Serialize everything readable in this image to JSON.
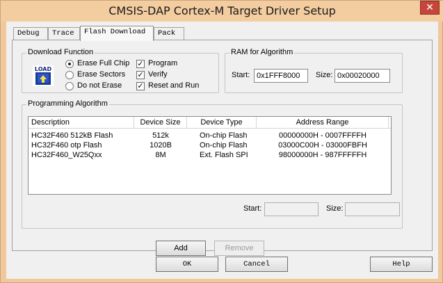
{
  "window": {
    "title": "CMSIS-DAP Cortex-M Target Driver Setup",
    "close_glyph": "✕"
  },
  "tabs": [
    {
      "label": "Debug",
      "active": false
    },
    {
      "label": "Trace",
      "active": false
    },
    {
      "label": "Flash Download",
      "active": true
    },
    {
      "label": "Pack",
      "active": false
    }
  ],
  "download_function": {
    "legend": "Download Function",
    "icon": "load-icon",
    "icon_text": "LOAD",
    "erase_options": [
      {
        "label": "Erase Full Chip",
        "selected": true
      },
      {
        "label": "Erase Sectors",
        "selected": false
      },
      {
        "label": "Do not Erase",
        "selected": false
      }
    ],
    "checks": [
      {
        "label": "Program",
        "checked": true
      },
      {
        "label": "Verify",
        "checked": true
      },
      {
        "label": "Reset and Run",
        "checked": true
      }
    ],
    "check_glyph": "✓"
  },
  "ram_for_algorithm": {
    "legend": "RAM for Algorithm",
    "start_label": "Start:",
    "start_value": "0x1FFF8000",
    "size_label": "Size:",
    "size_value": "0x00020000"
  },
  "programming_algorithm": {
    "legend": "Programming Algorithm",
    "columns": [
      "Description",
      "Device Size",
      "Device Type",
      "Address Range"
    ],
    "rows": [
      [
        "HC32F460 512kB Flash",
        "512k",
        "On-chip Flash",
        "00000000H - 0007FFFFH"
      ],
      [
        "HC32F460 otp Flash",
        "1020B",
        "On-chip Flash",
        "03000C00H - 03000FBFH"
      ],
      [
        "HC32F460_W25Qxx",
        "8M",
        "Ext. Flash SPI",
        "98000000H - 987FFFFFH"
      ]
    ],
    "start_label": "Start:",
    "start_value": "",
    "size_label": "Size:",
    "size_value": "",
    "add_label": "Add",
    "remove_label": "Remove"
  },
  "footer": {
    "ok_label": "OK",
    "cancel_label": "Cancel",
    "help_label": "Help"
  }
}
